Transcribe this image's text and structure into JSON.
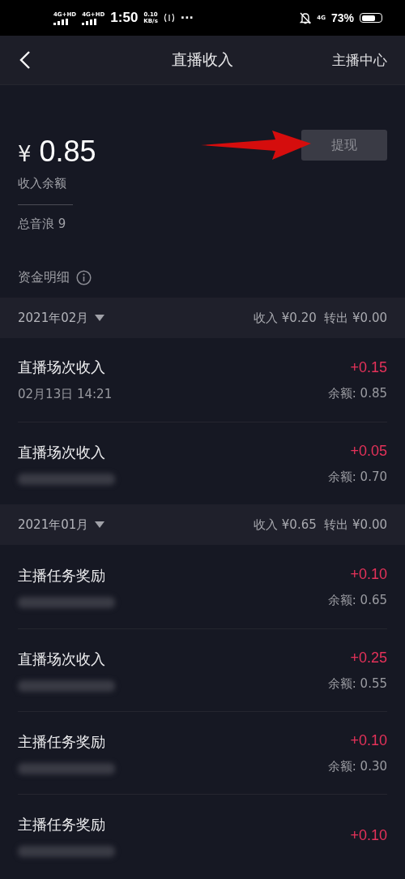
{
  "status_bar": {
    "networks": [
      "4G+HD",
      "4G+HD"
    ],
    "time": "1:50",
    "speed_value": "0.10",
    "speed_unit": "KB/s",
    "more": "···",
    "data_label": "4G",
    "battery": "73%"
  },
  "header": {
    "title": "直播收入",
    "action": "主播中心"
  },
  "balance": {
    "currency": "¥",
    "amount": "0.85",
    "label": "收入余额",
    "withdraw_button": "提现",
    "total_label": "总音浪 9"
  },
  "details_title": "资金明细",
  "groups": [
    {
      "month": "2021年02月",
      "summary": "收入 ¥0.20  转出 ¥0.00",
      "entries": [
        {
          "title": "直播场次收入",
          "date": "02月13日 14:21",
          "amount": "+0.15",
          "balance": "余额: 0.85"
        },
        {
          "title": "直播场次收入",
          "date_blurred": true,
          "amount": "+0.05",
          "balance": "余额: 0.70"
        }
      ]
    },
    {
      "month": "2021年01月",
      "summary": "收入 ¥0.65  转出 ¥0.00",
      "entries": [
        {
          "title": "主播任务奖励",
          "date_blurred": true,
          "amount": "+0.10",
          "balance": "余额: 0.65"
        },
        {
          "title": "直播场次收入",
          "date_blurred": true,
          "amount": "+0.25",
          "balance": "余额: 0.55"
        },
        {
          "title": "主播任务奖励",
          "date_blurred": true,
          "amount": "+0.10",
          "balance": "余额: 0.30"
        },
        {
          "title": "主播任务奖励",
          "date_blurred": true,
          "amount": "+0.10"
        }
      ]
    }
  ]
}
